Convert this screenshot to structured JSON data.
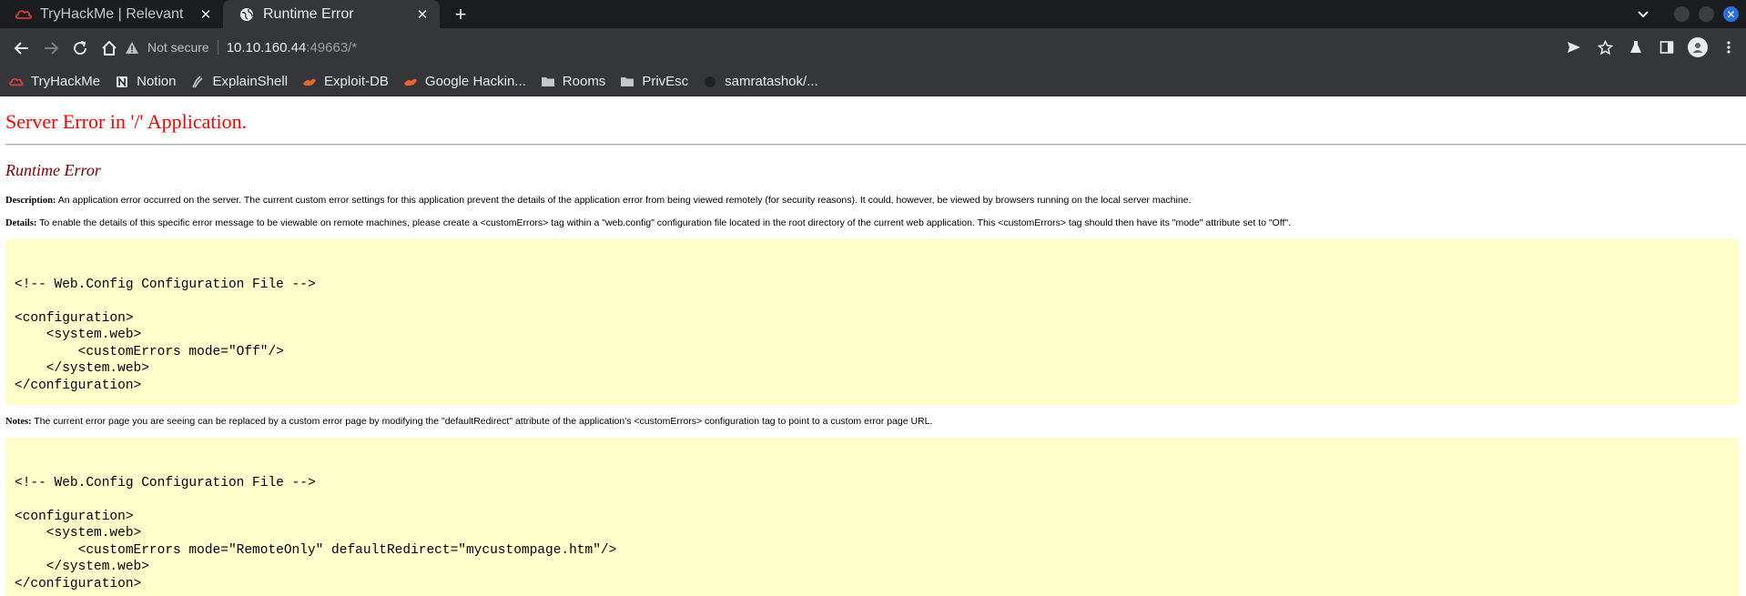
{
  "browser": {
    "tabs": [
      {
        "title": "TryHackMe | Relevant",
        "active": false,
        "icon": "tryhackme-logo-icon"
      },
      {
        "title": "Runtime Error",
        "active": true,
        "icon": "globe-icon"
      }
    ],
    "new_tab_label": "+",
    "address": {
      "security_label": "Not secure",
      "host": "10.10.160.44",
      "path": ":49663/*"
    },
    "bookmarks": [
      {
        "label": "TryHackMe",
        "icon": "tryhackme-logo-icon"
      },
      {
        "label": "Notion",
        "icon": "notion-icon"
      },
      {
        "label": "ExplainShell",
        "icon": "explainshell-icon"
      },
      {
        "label": "Exploit-DB",
        "icon": "exploit-db-icon"
      },
      {
        "label": "Google Hackin...",
        "icon": "google-hacking-icon"
      },
      {
        "label": "Rooms",
        "icon": "folder-icon"
      },
      {
        "label": "PrivEsc",
        "icon": "folder-icon"
      },
      {
        "label": "samratashok/...",
        "icon": "github-icon"
      }
    ],
    "colors": {
      "chrome_dark": "#202124",
      "toolbar": "#35363a",
      "close_button": "#2b6fdc"
    }
  },
  "page": {
    "heading": "Server Error in '/' Application.",
    "subheading": "Runtime Error",
    "description_label": "Description:",
    "description_text": " An application error occurred on the server. The current custom error settings for this application prevent the details of the application error from being viewed remotely (for security reasons). It could, however, be viewed by browsers running on the local server machine.",
    "details_label": "Details:",
    "details_text": " To enable the details of this specific error message to be viewable on remote machines, please create a <customErrors> tag within a \"web.config\" configuration file located in the root directory of the current web application. This <customErrors> tag should then have its \"mode\" attribute set to \"Off\".",
    "code_block_1": "\n<!-- Web.Config Configuration File -->\n\n<configuration>\n    <system.web>\n        <customErrors mode=\"Off\"/>\n    </system.web>\n</configuration>",
    "notes_label": "Notes:",
    "notes_text": " The current error page you are seeing can be replaced by a custom error page by modifying the \"defaultRedirect\" attribute of the application's <customErrors> configuration tag to point to a custom error page URL.",
    "code_block_2": "\n<!-- Web.Config Configuration File -->\n\n<configuration>\n    <system.web>\n        <customErrors mode=\"RemoteOnly\" defaultRedirect=\"mycustompage.htm\"/>\n    </system.web>\n</configuration>",
    "colors": {
      "heading": "#ff0000",
      "subheading": "#800000",
      "code_background": "#ffffcc"
    }
  }
}
